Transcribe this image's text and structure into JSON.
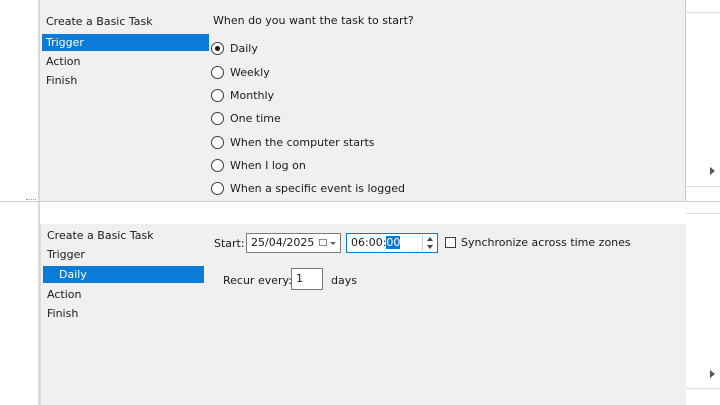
{
  "top": {
    "wizard_steps": [
      "Create a Basic Task",
      "Trigger",
      "Action",
      "Finish"
    ],
    "selected_step": "Trigger",
    "question": "When do you want the task to start?",
    "options": [
      {
        "label": "Daily",
        "checked": true
      },
      {
        "label": "Weekly",
        "checked": false
      },
      {
        "label": "Monthly",
        "checked": false
      },
      {
        "label": "One time",
        "checked": false
      },
      {
        "label": "When the computer starts",
        "checked": false
      },
      {
        "label": "When I log on",
        "checked": false
      },
      {
        "label": "When a specific event is logged",
        "checked": false
      }
    ]
  },
  "bottom": {
    "wizard_steps": [
      "Create a Basic Task",
      "Trigger",
      "Daily",
      "Action",
      "Finish"
    ],
    "selected_step": "Daily",
    "start_label": "Start:",
    "start_date": "25/04/2025",
    "start_time_prefix": "06:00:",
    "start_time_selected": "00",
    "sync_label": "Synchronize across time zones",
    "sync_checked": false,
    "recur_label": "Recur every:",
    "recur_value": "1",
    "recur_unit": "days"
  },
  "icons": {
    "calendar": "calendar-dropdown-icon",
    "spin": "time-spin-icon",
    "expand": "chevron-right-icon"
  },
  "colors": {
    "selection": "#0a7bd7",
    "dialog_bg": "#f0f0f0"
  }
}
